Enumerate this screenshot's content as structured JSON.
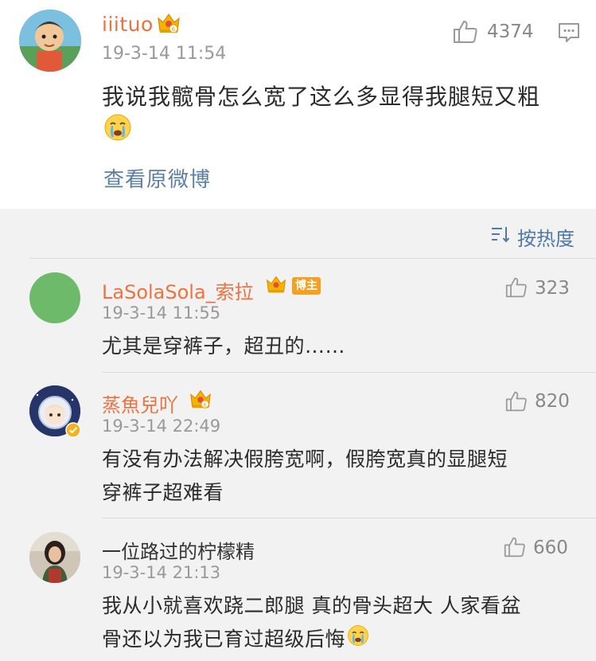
{
  "main_comment": {
    "username": "iiituo",
    "time": "19-3-14 11:54",
    "likes": "4374",
    "text": "我说我髋骨怎么宽了这么多显得我腿短又粗",
    "emoji": "crying-face",
    "view_original_label": "查看原微博"
  },
  "sort": {
    "label": "按热度"
  },
  "replies": [
    {
      "username": "LaSolaSola_索拉",
      "badge": "博主",
      "time": "19-3-14 11:55",
      "likes": "323",
      "text": "尤其是穿裤子，超丑的……",
      "avatar_color": "#6dbb6a"
    },
    {
      "username": "蒸魚兒吖",
      "time": "19-3-14 22:49",
      "likes": "820",
      "text_line1": "有没有办法解决假胯宽啊，假胯宽真的显腿短",
      "text_line2": "穿裤子超难看"
    },
    {
      "username": "一位路过的柠檬精",
      "time": "19-3-14 21:13",
      "likes": "660",
      "text_line1": "我从小就喜欢跷二郎腿 真的骨头超大 人家看盆",
      "text_line2": "骨还以为我已育过超级后悔"
    }
  ],
  "colors": {
    "username_orange": "#eb7340",
    "link_blue": "#5b7fa6",
    "background": "#f2f2f2",
    "crown_gold": "#f5b400",
    "verified_yellow": "#f6b11c"
  }
}
